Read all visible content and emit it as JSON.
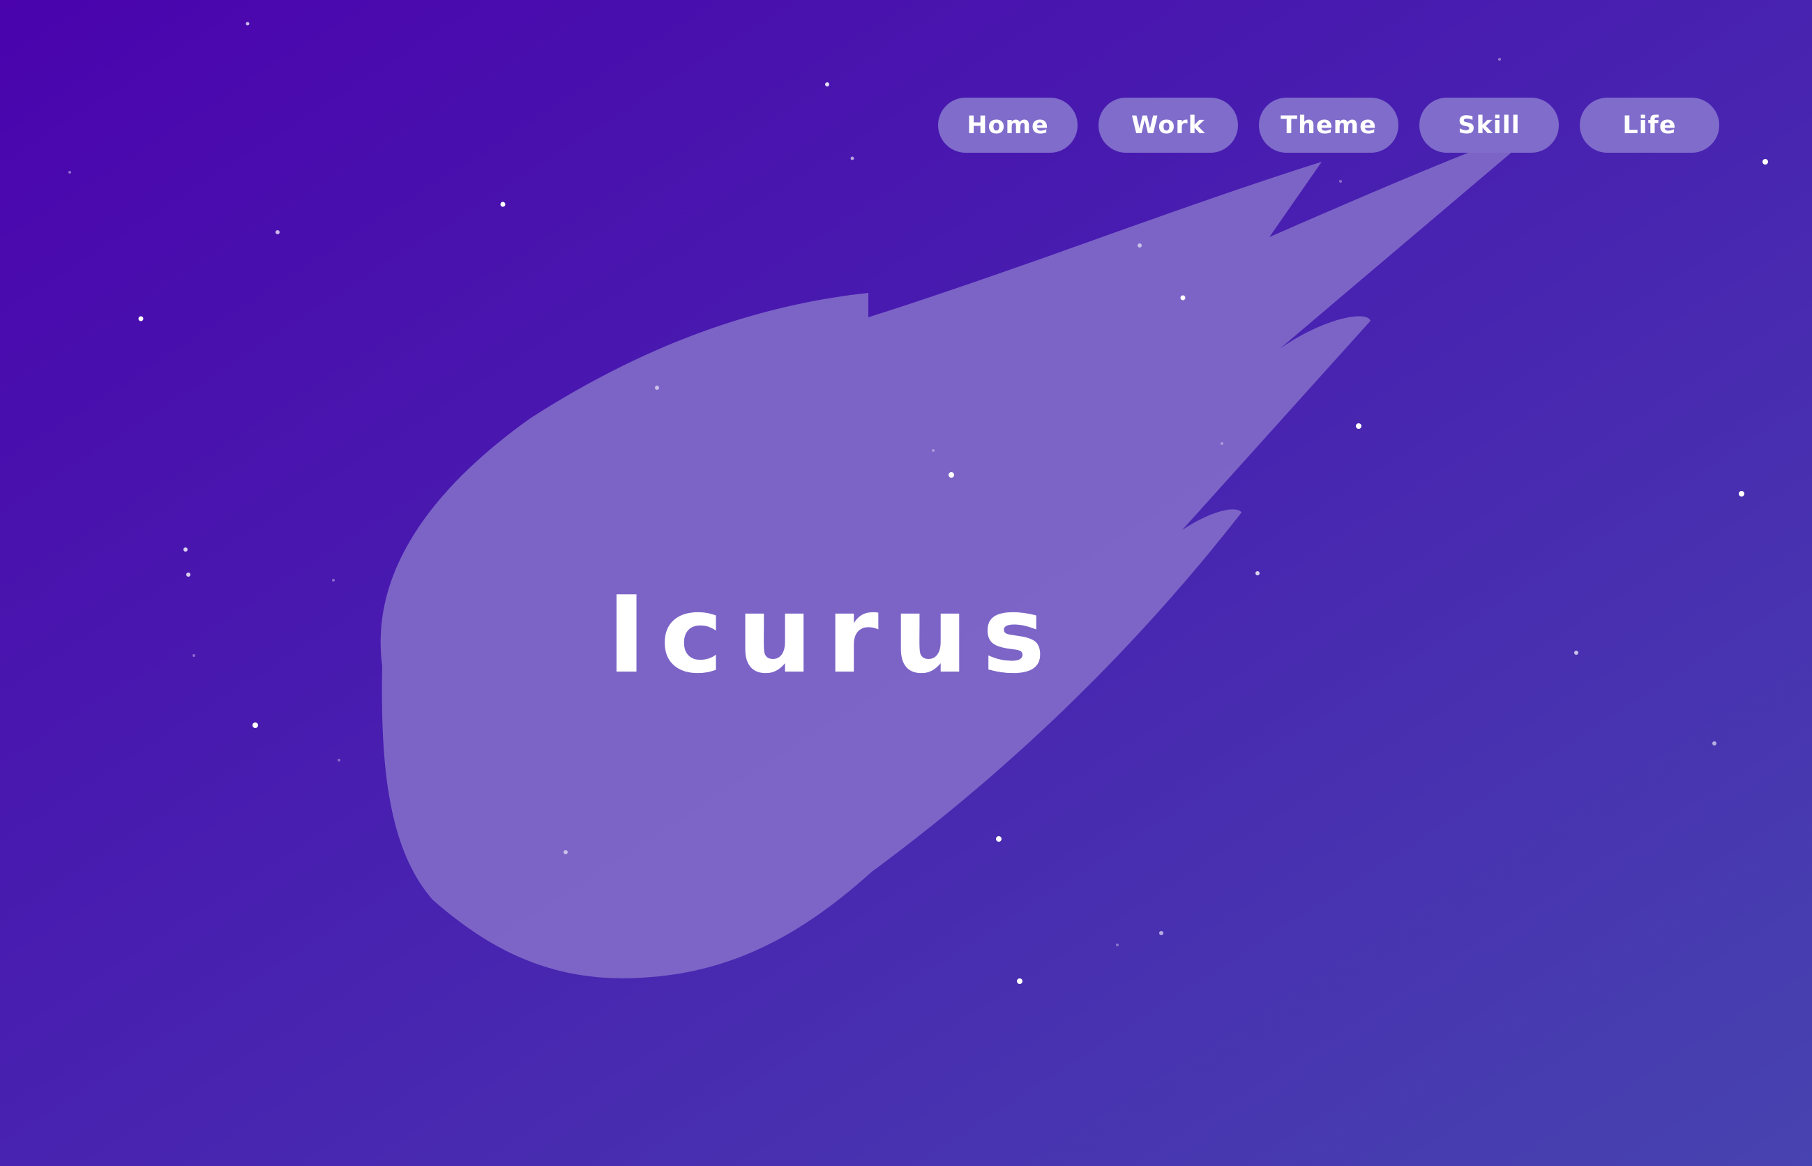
{
  "site": {
    "title": "Icurus"
  },
  "nav": {
    "items": [
      {
        "label": "Home"
      },
      {
        "label": "Work"
      },
      {
        "label": "Theme"
      },
      {
        "label": "Skill"
      },
      {
        "label": "Life"
      }
    ]
  },
  "colors": {
    "bg_start": "#4a04ad",
    "bg_end": "#473fb0",
    "comet": "#8068c8",
    "button_bg": "#7f6ccb",
    "text": "#ffffff",
    "star": "#ffffff"
  }
}
